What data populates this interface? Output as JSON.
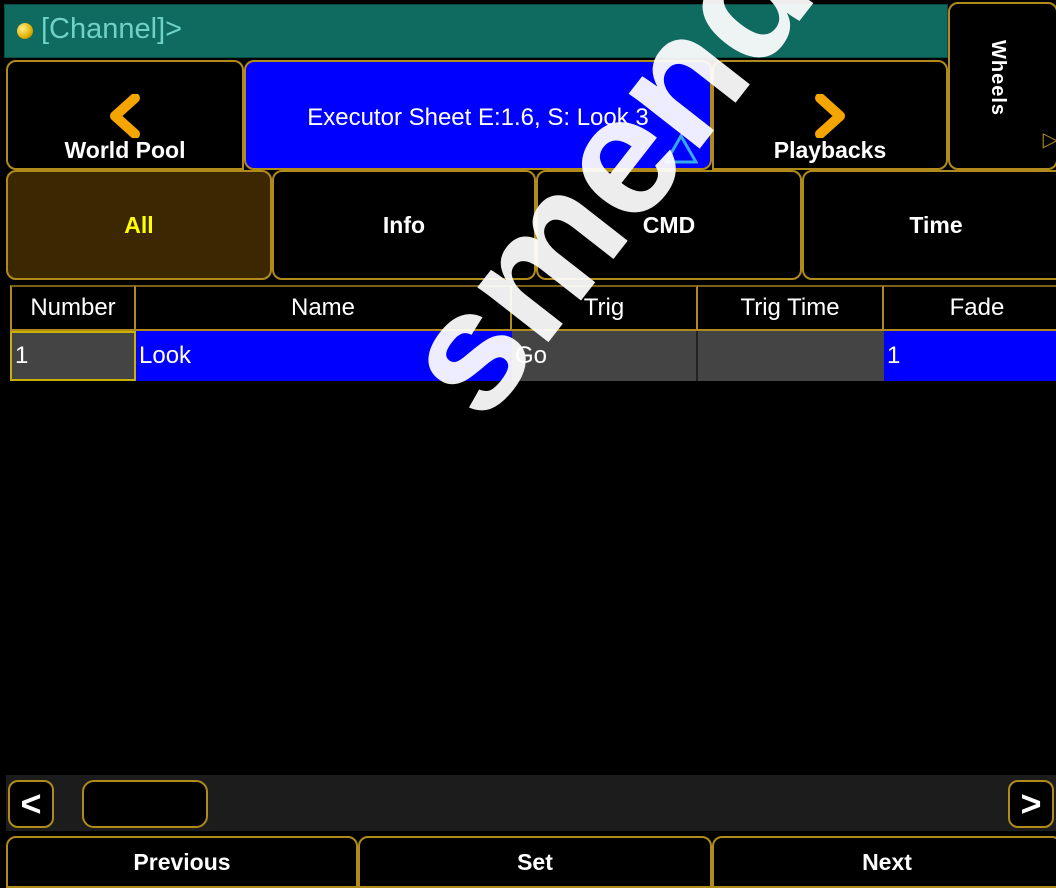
{
  "command_line": {
    "text": "[Channel]>"
  },
  "header": {
    "left_button": {
      "label": "World Pool",
      "icon": "chevron-left-icon"
    },
    "center_title": "Executor Sheet E:1.6, S: Look 3",
    "right_button": {
      "label": "Playbacks",
      "icon": "chevron-right-icon"
    },
    "side_tab": {
      "label": "Wheels"
    }
  },
  "tabs": [
    {
      "label": "All",
      "active": true
    },
    {
      "label": "Info",
      "active": false
    },
    {
      "label": "CMD",
      "active": false
    },
    {
      "label": "Time",
      "active": false
    }
  ],
  "table": {
    "columns": [
      "Number",
      "Name",
      "Trig",
      "Trig Time",
      "Fade"
    ],
    "rows": [
      {
        "number": "1",
        "name": "Look",
        "trig": "Go",
        "trig_time": "",
        "fade": "1"
      }
    ]
  },
  "scrollbar": {
    "left_symbol": "<",
    "right_symbol": ">"
  },
  "bottom": {
    "previous": "Previous",
    "set": "Set",
    "next": "Next"
  },
  "watermark": "smendoza.co",
  "colors": {
    "accent_border": "#b08a1a",
    "command_bg": "#0f6a5f",
    "selection_blue": "#0000ff",
    "active_tab_bg": "#3c2800",
    "active_tab_text": "#ffff00",
    "arrow_orange": "#f5a500"
  }
}
